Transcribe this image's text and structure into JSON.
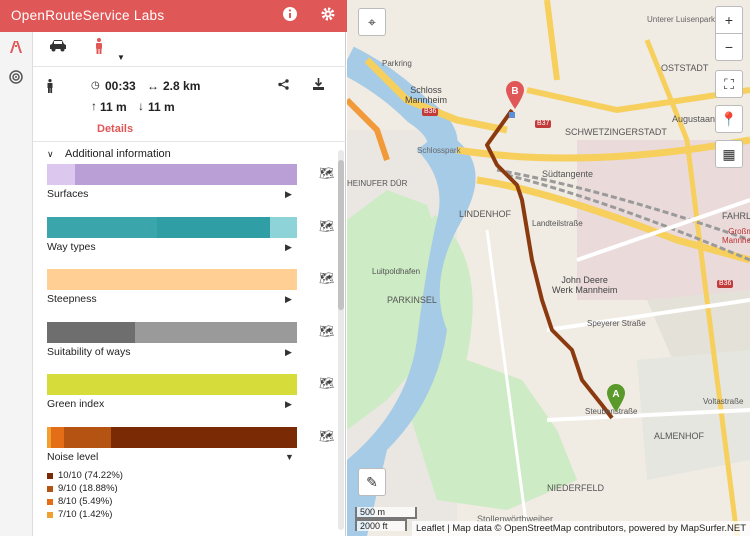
{
  "app": {
    "title": "OpenRouteService Labs"
  },
  "summary": {
    "duration": "00:33",
    "distance": "2.8 km",
    "ascent": "11 m",
    "descent": "11 m",
    "details_link": "Details"
  },
  "extra_info": {
    "heading": "Additional information",
    "categories": [
      {
        "label": "Surfaces",
        "segments": [
          {
            "color": "#dcc8ee",
            "value": 0.11
          },
          {
            "color": "#b99fd6",
            "value": 0.89
          }
        ]
      },
      {
        "label": "Way types",
        "segments": [
          {
            "color": "#3aa6ac",
            "value": 0.44
          },
          {
            "color": "#2f9ea5",
            "value": 0.45
          },
          {
            "color": "#8ed3d8",
            "value": 0.11
          }
        ]
      },
      {
        "label": "Steepness",
        "segments": [
          {
            "color": "#ffcf94",
            "value": 1.0
          }
        ]
      },
      {
        "label": "Suitability of ways",
        "segments": [
          {
            "color": "#6e6e6e",
            "value": 0.35
          },
          {
            "color": "#9a9a9a",
            "value": 0.65
          }
        ]
      },
      {
        "label": "Green index",
        "segments": [
          {
            "color": "#d6dd3a",
            "value": 1.0
          }
        ]
      },
      {
        "label": "Noise level",
        "segments": [
          {
            "color": "#f0a030",
            "value": 0.0142
          },
          {
            "color": "#e46e18",
            "value": 0.0549
          },
          {
            "color": "#b45312",
            "value": 0.1888
          },
          {
            "color": "#7a2a05",
            "value": 0.7422
          }
        ]
      }
    ],
    "legend": [
      {
        "label": "10/10 (74.22%)",
        "color": "#7a2a05"
      },
      {
        "label": "9/10 (18.88%)",
        "color": "#b45312"
      },
      {
        "label": "8/10 (5.49%)",
        "color": "#e46e18"
      },
      {
        "label": "7/10 (1.42%)",
        "color": "#f0a030"
      }
    ]
  },
  "map": {
    "labels": [
      {
        "t": "Schloss\nMannheim"
      },
      {
        "t": "Schlosspark"
      },
      {
        "t": "LINDENHOF"
      },
      {
        "t": "SCHWETZINGERSTADT"
      },
      {
        "t": "OSTSTADT"
      },
      {
        "t": "PARKINSEL"
      },
      {
        "t": "John Deere\nWerk Mannheim"
      },
      {
        "t": "ALMENHOF"
      },
      {
        "t": "NIEDERFELD"
      },
      {
        "t": "Unterer Luisenpark"
      },
      {
        "t": "Augustaanlage"
      },
      {
        "t": "Südtangente"
      },
      {
        "t": "Landteilstraße"
      },
      {
        "t": "Speyerer Straße"
      },
      {
        "t": "Steubenstraße"
      },
      {
        "t": "Luitpoldhafen"
      },
      {
        "t": "HEINUFER DÜR"
      },
      {
        "t": "FAHRLA"
      },
      {
        "t": "Großm\nMannheim"
      },
      {
        "t": "Voltastraße"
      },
      {
        "t": "Stollenwörthweiher"
      },
      {
        "t": "Parkring"
      },
      {
        "t": "B36"
      },
      {
        "t": "B37"
      },
      {
        "t": "B36"
      }
    ],
    "scale": {
      "metric": "500 m",
      "imperial": "2000 ft"
    },
    "attribution": "Leaflet | Map data © OpenStreetMap contributors, powered by MapSurfer.NET",
    "markers": {
      "start": "A",
      "end": "B"
    }
  },
  "colors": {
    "brand": "#e05757",
    "route": "#8b3a10"
  }
}
